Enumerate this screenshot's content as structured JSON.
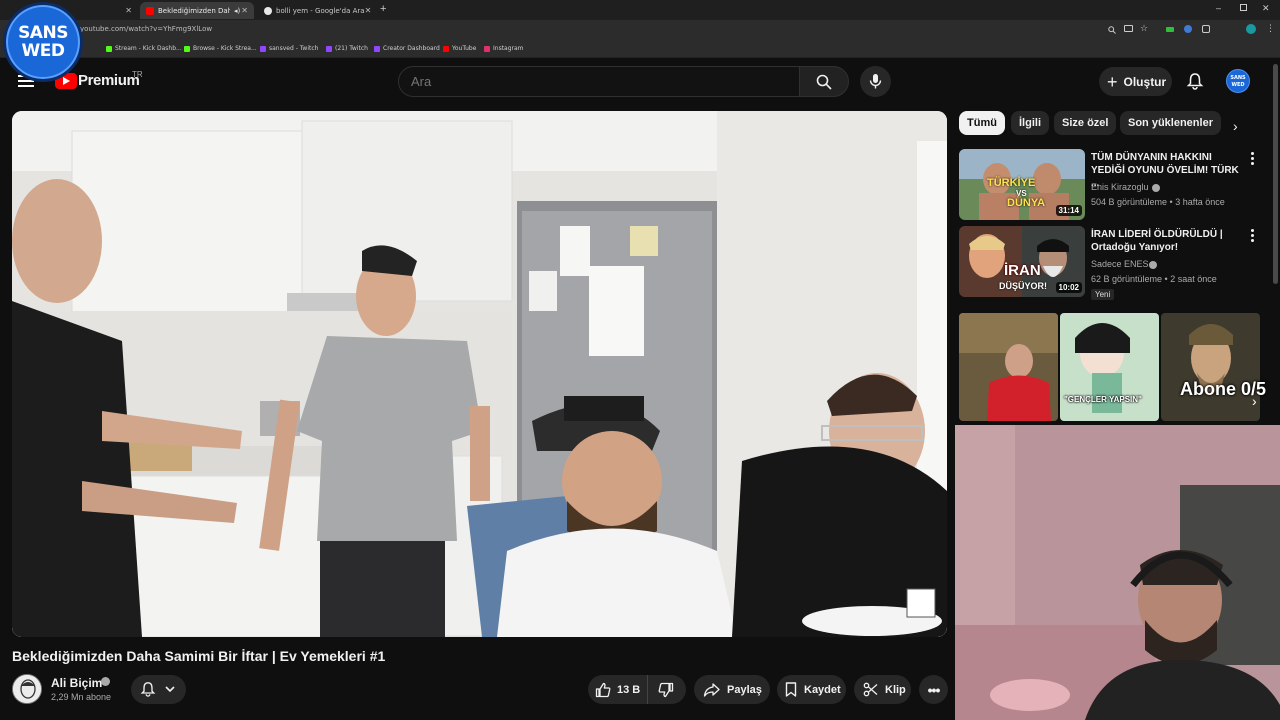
{
  "browser": {
    "tabs": [
      {
        "label": "",
        "active": false
      },
      {
        "label": "Beklediğimizden Daha Sam",
        "active": true
      },
      {
        "label": "bolli yem - Google'da Ara",
        "active": false
      }
    ],
    "url": "youtube.com/watch?v=YhFmg9XlLow",
    "bookmarks": [
      "Stream - Kick Dashb...",
      "Browse - Kick Strea...",
      "sansved - Twitch",
      "(21) Twitch",
      "Creator Dashboard",
      "YouTube",
      "Instagram"
    ]
  },
  "overlay_logo": {
    "line1": "SANS",
    "line2": "WED"
  },
  "header": {
    "logo_text": "Premium",
    "region": "TR",
    "search_placeholder": "Ara",
    "create_label": "Oluştur",
    "avatar_text": "SANS WED"
  },
  "video": {
    "title": "Beklediğimizden Daha Samimi Bir İftar | Ev Yemekleri #1",
    "channel": "Ali Biçim",
    "subscribers": "2,29 Mn abone",
    "likes": "13 B",
    "share_label": "Paylaş",
    "save_label": "Kaydet",
    "clip_label": "Klip"
  },
  "sidebar": {
    "chips": [
      "Tümü",
      "İlgili",
      "Size özel",
      "Son yüklenenler"
    ],
    "recommendations": [
      {
        "title": "TÜM DÜNYANIN HAKKINI YEDİĞİ OYUNU ÖVELİM! TÜRK ...",
        "channel": "Enis Kirazoglu",
        "meta": "504 B görüntüleme • 3 hafta önce",
        "duration": "31:14",
        "thumb_text_1": "TÜRKİYE",
        "thumb_text_2": "VS",
        "thumb_text_3": "DÜNYA"
      },
      {
        "title": "İRAN LİDERİ ÖLDÜRÜLDÜ | Ortadoğu Yanıyor!",
        "channel": "Sadece ENES",
        "meta": "62 B görüntüleme • 2 saat önce",
        "duration": "10:02",
        "badge": "Yeni",
        "thumb_text_1": "İRAN",
        "thumb_text_2": "DÜŞÜYOR!"
      }
    ],
    "shorts": {
      "overlay": "Abone 0/5",
      "caption_2": "\"GENÇLER YAPSIN\""
    }
  },
  "colors": {
    "accent": "#ff0000",
    "background": "#0f0f0f",
    "pill": "#272727",
    "brand_blue": "#1a68d8"
  }
}
